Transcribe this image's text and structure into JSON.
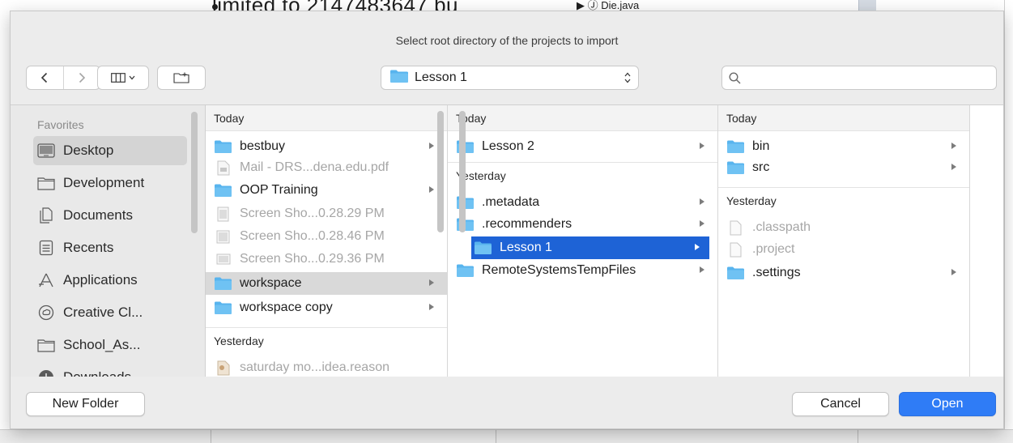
{
  "background": {
    "doc_text": "limited to 2147483647 bu",
    "file_label": "▶ Ⓙ Die.java"
  },
  "dialog": {
    "title": "Select root directory of the projects to import",
    "path_popup": "Lesson 1",
    "search": {
      "value": "",
      "placeholder": ""
    }
  },
  "sidebar": {
    "heading": "Favorites",
    "items": [
      {
        "label": "Desktop",
        "icon": "desktop-icon",
        "selected": true
      },
      {
        "label": "Development",
        "icon": "folder-icon"
      },
      {
        "label": "Documents",
        "icon": "documents-icon"
      },
      {
        "label": "Recents",
        "icon": "recents-icon"
      },
      {
        "label": "Applications",
        "icon": "applications-icon"
      },
      {
        "label": "Creative Cl...",
        "icon": "creative-cloud-icon"
      },
      {
        "label": "School_As...",
        "icon": "folder-icon"
      },
      {
        "label": "Downloads",
        "icon": "downloads-icon"
      }
    ]
  },
  "columns": [
    {
      "groups": [
        {
          "heading": "Today",
          "items": [
            {
              "name": "bestbuy",
              "type": "folder",
              "chevron": true
            },
            {
              "name": "Mail - DRS...dena.edu.pdf",
              "type": "pdf",
              "dim": true
            },
            {
              "name": "OOP Training",
              "type": "folder",
              "chevron": true
            },
            {
              "name": "Screen Sho...0.28.29 PM",
              "type": "image",
              "dim": true
            },
            {
              "name": "Screen Sho...0.28.46 PM",
              "type": "image",
              "dim": true
            },
            {
              "name": "Screen Sho...0.29.36 PM",
              "type": "image",
              "dim": true
            },
            {
              "name": "workspace",
              "type": "folder",
              "chevron": true,
              "highlight": true
            },
            {
              "name": "workspace copy",
              "type": "folder",
              "chevron": true
            }
          ]
        },
        {
          "heading": "Yesterday",
          "items": [
            {
              "name": "saturday mo...idea.reason",
              "type": "doc",
              "dim": true
            }
          ]
        }
      ]
    },
    {
      "groups": [
        {
          "heading": "Today",
          "items": [
            {
              "name": "Lesson 2",
              "type": "folder",
              "chevron": true
            }
          ]
        },
        {
          "heading": "Yesterday",
          "items": [
            {
              "name": ".metadata",
              "type": "folder",
              "chevron": true
            },
            {
              "name": ".recommenders",
              "type": "folder",
              "chevron": true
            },
            {
              "name": "Lesson 1",
              "type": "folder",
              "chevron": true,
              "selected": true
            },
            {
              "name": "RemoteSystemsTempFiles",
              "type": "folder",
              "chevron": true
            }
          ]
        }
      ]
    },
    {
      "groups": [
        {
          "heading": "Today",
          "items": [
            {
              "name": "bin",
              "type": "folder",
              "chevron": true
            },
            {
              "name": "src",
              "type": "folder",
              "chevron": true
            }
          ]
        },
        {
          "heading": "Yesterday",
          "items": [
            {
              "name": ".classpath",
              "type": "file",
              "dim": true
            },
            {
              "name": ".project",
              "type": "file",
              "dim": true
            },
            {
              "name": ".settings",
              "type": "folder",
              "chevron": true
            }
          ]
        }
      ]
    }
  ],
  "buttons": {
    "new_folder": "New Folder",
    "cancel": "Cancel",
    "open": "Open"
  },
  "colors": {
    "folder": "#58b4ee",
    "selection": "#1e63d6",
    "primary_button": "#2f7cf6"
  }
}
